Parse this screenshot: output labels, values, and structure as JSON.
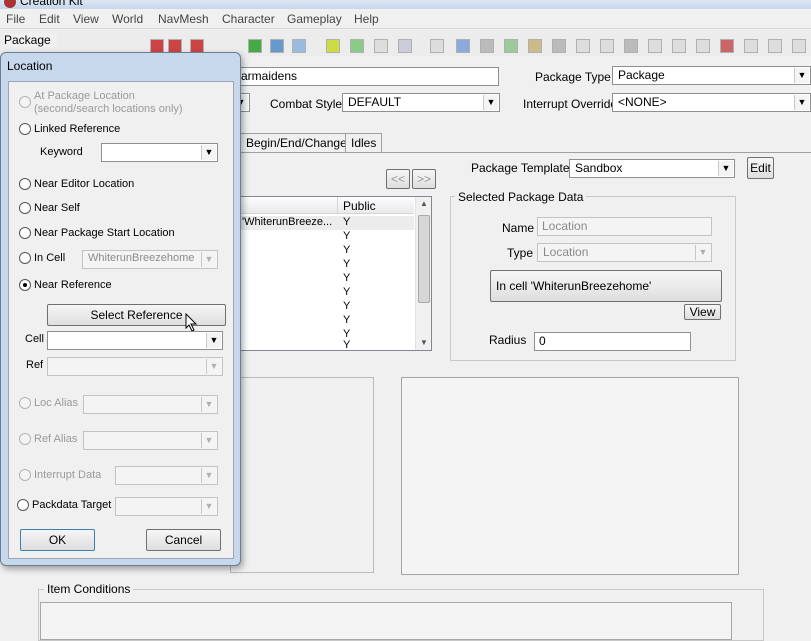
{
  "window": {
    "title": "Creation Kit"
  },
  "menu": [
    "File",
    "Edit",
    "View",
    "World",
    "NavMesh",
    "Character",
    "Gameplay",
    "Help"
  ],
  "package_header": "Package",
  "main": {
    "id_value": "armaidens",
    "package_type_label": "Package Type",
    "package_type_value": "Package",
    "combat_style_label": "Combat Style",
    "combat_style_value": "DEFAULT",
    "interrupt_override_label": "Interrupt Override",
    "interrupt_override_value": "<NONE>",
    "tabs": [
      "Begin/End/Change",
      "Idles"
    ],
    "nav_prev": "<<",
    "nav_next": ">>",
    "package_template_label": "Package Template",
    "package_template_value": "Sandbox",
    "edit_button": "Edit",
    "list": {
      "header_public": "Public",
      "rows": [
        {
          "name": "'WhiterunBreeze...",
          "public": "Y"
        },
        {
          "name": "",
          "public": "Y"
        },
        {
          "name": "",
          "public": "Y"
        },
        {
          "name": "",
          "public": "Y"
        },
        {
          "name": "",
          "public": "Y"
        },
        {
          "name": "",
          "public": "Y"
        },
        {
          "name": "",
          "public": "Y"
        },
        {
          "name": "",
          "public": "Y"
        },
        {
          "name": "",
          "public": "Y"
        },
        {
          "name": "",
          "public": "Y"
        }
      ]
    },
    "selected_data": {
      "group_title": "Selected Package Data",
      "name_label": "Name",
      "name_value": "Location",
      "type_label": "Type",
      "type_value": "Location",
      "location_text": "In cell 'WhiterunBreezehome'",
      "view_button": "View",
      "radius_label": "Radius",
      "radius_value": "0"
    },
    "item_conditions_title": "Item Conditions"
  },
  "dialog": {
    "title": "Location",
    "options": {
      "at_package_location": "At Package Location",
      "at_package_location_sub": "(second/search locations only)",
      "linked_reference": "Linked Reference",
      "keyword_label": "Keyword",
      "keyword_value": "",
      "near_editor_location": "Near Editor Location",
      "near_self": "Near Self",
      "near_package_start": "Near Package Start Location",
      "in_cell": "In Cell",
      "in_cell_value": "WhiterunBreezehome",
      "near_reference": "Near Reference",
      "select_reference_button": "Select Reference",
      "cell_label": "Cell",
      "cell_value": "",
      "ref_label": "Ref",
      "ref_value": "",
      "loc_alias": "Loc Alias",
      "ref_alias": "Ref Alias",
      "interrupt_data": "Interrupt Data",
      "packdata_target": "Packdata Target"
    },
    "selected_option": "near_reference",
    "ok_button": "OK",
    "cancel_button": "Cancel"
  }
}
